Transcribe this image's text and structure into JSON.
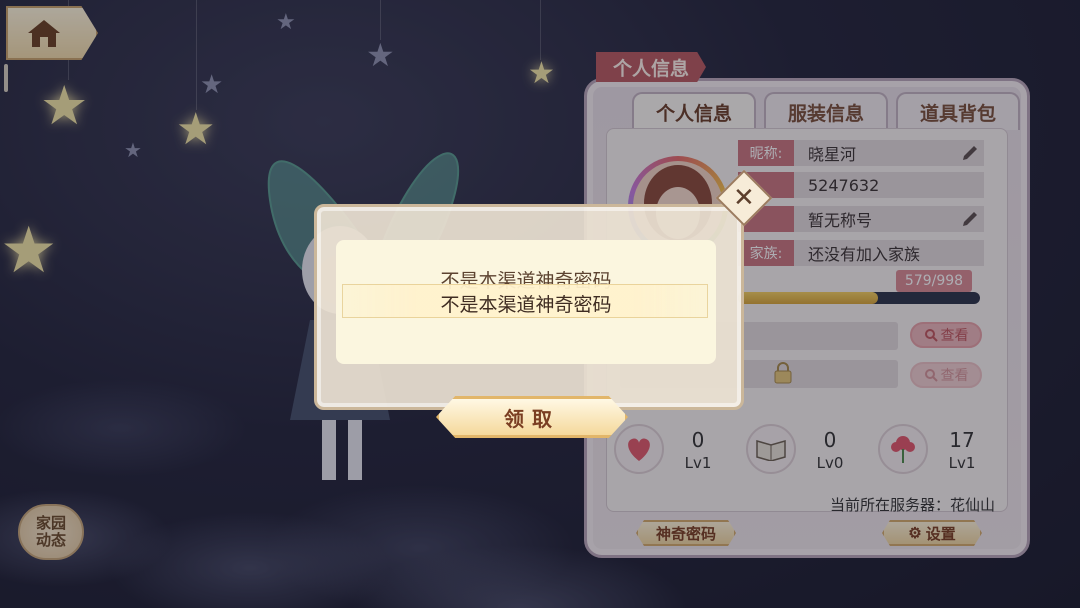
{
  "icons": {
    "home": "home-icon",
    "edit": "pencil-icon",
    "search": "magnifier-icon",
    "lock": "lock-icon",
    "close": "close-icon",
    "gear": "gear-icon",
    "heart": "heart-icon",
    "book": "book-icon",
    "flower": "flower-icon"
  },
  "colors": {
    "tab_accent": "#b85a60",
    "label_bg": "#c9767e",
    "exp_fill": "#f4d060",
    "dialog_bg": "#fbf6df"
  },
  "side": {
    "family_label": "家园\n动态"
  },
  "panel": {
    "title": "个人信息",
    "tabs": [
      {
        "label": "个人信息",
        "active": true
      },
      {
        "label": "服装信息",
        "active": false
      },
      {
        "label": "道具背包",
        "active": false
      }
    ],
    "fields": [
      {
        "label": "昵称:",
        "value": "晓星河"
      },
      {
        "label": "",
        "value": "5247632"
      },
      {
        "label": "",
        "value": "暂无称号"
      },
      {
        "label": "家族:",
        "value": "还没有加入家族"
      }
    ],
    "exp": {
      "text": "579/998",
      "fraction": 0.58
    },
    "view_label": "查看",
    "stats": [
      {
        "value": "0",
        "level": "Lv1"
      },
      {
        "value": "0",
        "level": "Lv0"
      },
      {
        "value": "17",
        "level": "Lv1"
      }
    ],
    "server": "当前所在服务器：花仙山",
    "magic_code_label": "神奇密码",
    "settings_label": "设置"
  },
  "dialog": {
    "message_back": "不是本渠道神奇密码",
    "message_front": "不是本渠道神奇密码",
    "claim_label": "领取"
  }
}
